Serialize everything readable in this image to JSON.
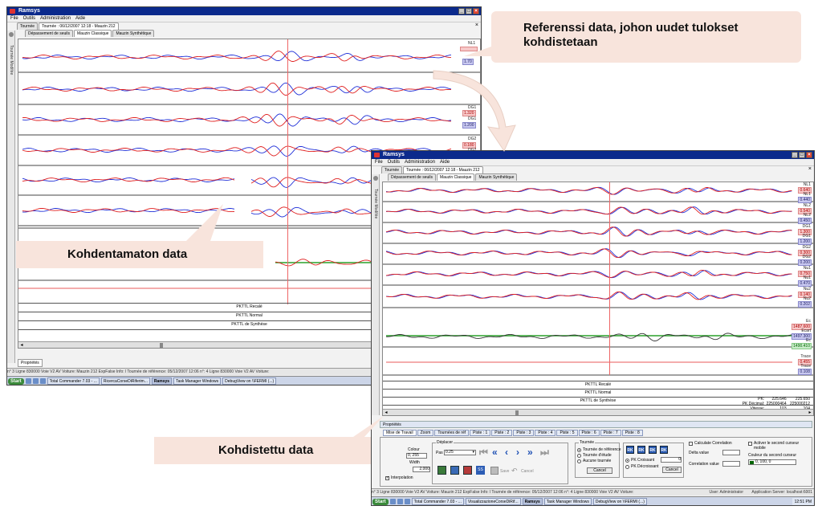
{
  "callouts": {
    "reference": "Referenssi data, johon uudet tulokset kohdistetaan",
    "unaligned": "Kohdentamaton data",
    "aligned": "Kohdistettu data"
  },
  "win1": {
    "title": "Ramsys",
    "menu": [
      "File",
      "Outils",
      "Administration",
      "Aide"
    ],
    "doc_tabs": [
      "Tournée",
      "Tournée : 06/12/2007 12:18 - Mauzin 212"
    ],
    "view_tabs": [
      "Dépassement de seuils",
      "Mauzin Classique",
      "Mauzin Synthétique"
    ],
    "sidebar_label": "Tournée Modifée",
    "channel_labels": [
      {
        "name": "NL1",
        "value": "1.70"
      },
      {
        "name": "NL2",
        "value": ""
      },
      {
        "name": "DG1",
        "value": "1.320"
      },
      {
        "name": "DG2",
        "value": "0.180"
      },
      {
        "name": "DG2",
        "value": ""
      }
    ],
    "value_rows": [
      {
        "a": "",
        "b": "1.70"
      },
      {
        "a": "1.320",
        "b": "1.200"
      },
      {
        "a": "0.180",
        "b": ""
      }
    ],
    "pktl_rows": [
      "PKTTL Recalé",
      "PKTTL Normal",
      "PKTTL de Synthèse"
    ],
    "panel_tab": "Propriétés",
    "status": "n° 3   Ligne 830000   Voie V2        AV Voiture: Mauzin 212 ExpFalse  Info: l Tournée de référence: 05/12/2007 12:06  n°: 4   Ligne 830000   Voie V2        AV Voiture:",
    "taskbar": {
      "start": "Start",
      "items": [
        "Total Commander 7.03 - ...",
        "RicercaCorseDiRiferim...",
        "Ramsys",
        "Task Manager Windows",
        "DebugView on \\\\FERMI (...)"
      ]
    }
  },
  "win2": {
    "title": "Ramsys",
    "menu": [
      "File",
      "Outils",
      "Administration",
      "Aide"
    ],
    "doc_tabs": [
      "Tournée",
      "Tournée : 06/12/2007 12:18 - Mauzin 212"
    ],
    "view_tabs": [
      "Dépassement de seuils",
      "Mauzin Classique",
      "Mauzin Synthétique"
    ],
    "sidebar_label": "Tournée Modifée",
    "channels": [
      {
        "name": "NL1",
        "v1": "0.640",
        "name2": "NL1",
        "v2": "0.440"
      },
      {
        "name": "NL2",
        "v1": "0.540",
        "name2": "NL2",
        "v2": "0.450"
      },
      {
        "name": "DG1",
        "v1": "1.300",
        "name2": "DG1",
        "v2": "1.200"
      },
      {
        "name": "DG2",
        "v1": "0.300",
        "name2": "DG2",
        "v2": "0.200"
      },
      {
        "name": "Nu1",
        "v1": "0.750",
        "name2": "Nu1",
        "v2": "0.470"
      },
      {
        "name": "Nu2",
        "v1": "0.140",
        "name2": "Nu2",
        "v2": "0.202"
      },
      {
        "name": "Ec",
        "v1": "1487.600",
        "name2": "Ecart",
        "v2": "1497.300",
        "name3": "Ec",
        "v3": "1490.410"
      },
      {
        "name": "Trace",
        "v1": "0.455",
        "name2": "Trace",
        "v2": "0.108"
      }
    ],
    "pktl_rows": [
      "PKTTL Recalé",
      "PKTTL Normal",
      "PKTTL de Synthèse"
    ],
    "pk_table": [
      {
        "label": "PK:",
        "a": "225.646",
        "b": "225.650"
      },
      {
        "label": "PK Décimal:",
        "a": "225000464",
        "b": "225000212"
      },
      {
        "label": "Vitesse:",
        "a": "103",
        "b": "104"
      }
    ],
    "panel_title": "Propriétés",
    "panel_tabs": [
      "Mise de Travail",
      "Zoom",
      "Tournées de réf",
      "Piste : 1",
      "Piste : 2",
      "Piste : 3",
      "Piste : 4",
      "Piste : 5",
      "Piste : 6",
      "Piste : 7",
      "Piste : 8"
    ],
    "props": {
      "colour_label": "Colour",
      "colour_value": "0, 255",
      "width_label": "Width",
      "width_value": "2,000",
      "interpolation": "Interpolation"
    },
    "deplacer": {
      "title": "Déplacer",
      "pas_label": "Pas",
      "pas_value": "0.25",
      "save": "Save",
      "cancel": "Cancel"
    },
    "tournee": {
      "title": "Tournée",
      "options": [
        "Tournée de référence",
        "Tournée d'étude",
        "Aucune tournée"
      ],
      "cancel": "Cancel"
    },
    "pk": {
      "buttons": [
        "RK",
        "RK",
        "RK",
        "RK"
      ],
      "options": [
        "PK Croissant",
        "PK Décroissant"
      ],
      "value": "0",
      "cancel": "Cancel"
    },
    "correlation": {
      "calc": "Calculate Correlation",
      "delta": "Delta value",
      "corr": "Correlation value"
    },
    "cursor": {
      "activate": "Activer le second curseur mobile",
      "colour_label": "Couleur du second curseur",
      "colour_value": "0, 100, 0"
    },
    "status": "n° 3   Ligne 830000   Voie V2        AV Voiture: Mauzin 212 ExpFalse  Info: l Tournée de référence: 05/12/2007 12:06  n°: 4   Ligne 830000   Voie V2        AV Voiture:",
    "status_right": [
      "User: Administrator",
      "Application Server: localhost:6001"
    ],
    "taskbar": {
      "start": "Start",
      "items": [
        "Total Commander 7.03 - ...",
        "VisualizzazioneCorseDiRif...",
        "Ramsys",
        "Task Manager Windows",
        "DebugView on \\\\FERMI (...)"
      ],
      "clock": "12:51 PM"
    }
  },
  "colors": {
    "reference_trace": "#2030d8",
    "study_trace": "#e02020",
    "cursor": "#e66666",
    "callout_bg": "#f8e4dc"
  }
}
